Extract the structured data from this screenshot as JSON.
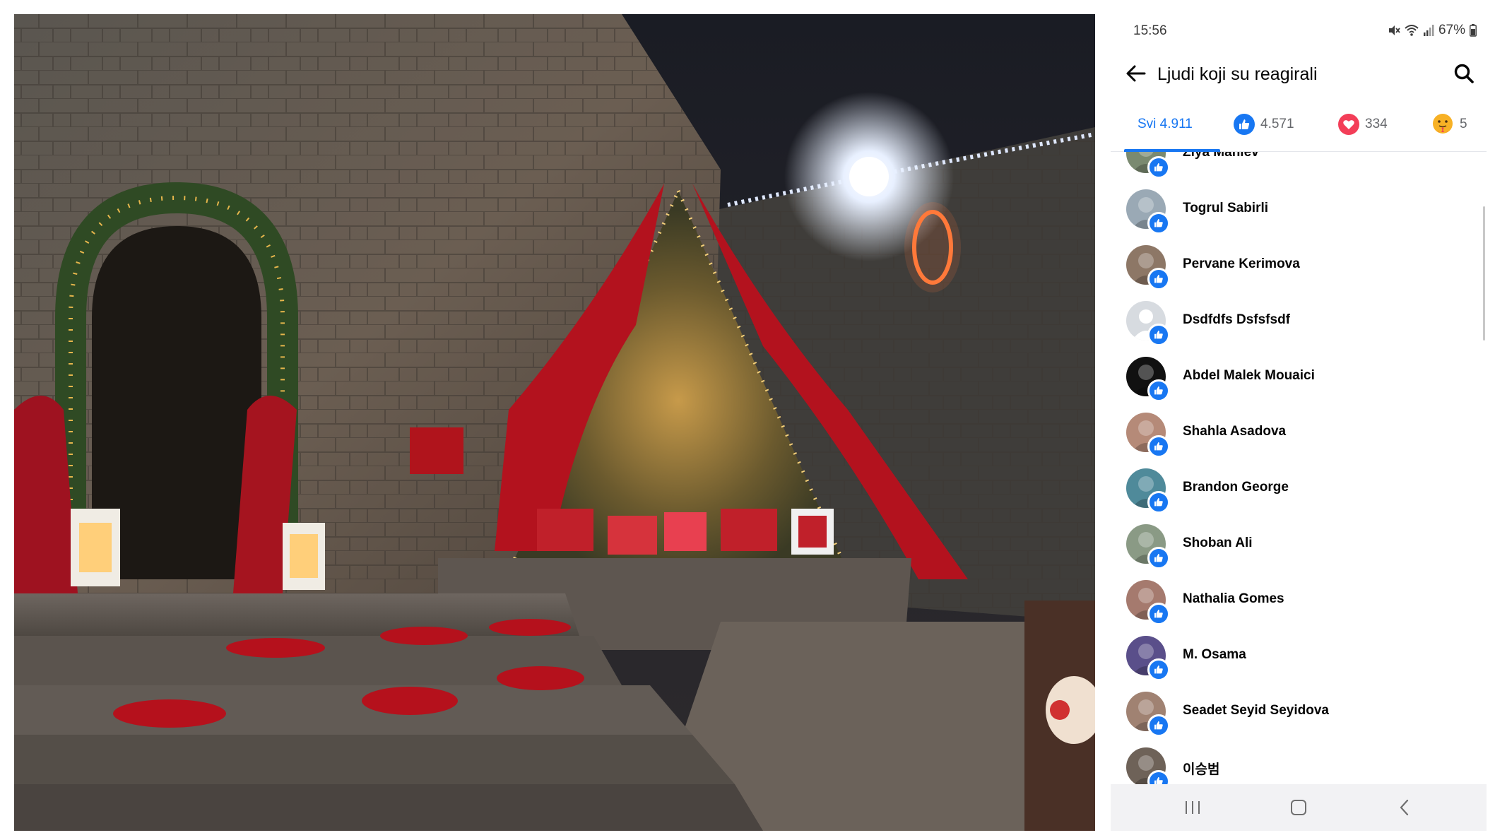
{
  "status_bar": {
    "time": "15:56",
    "battery": "67%",
    "icons": [
      "mute-icon",
      "wifi-icon",
      "signal-icon",
      "battery-icon"
    ]
  },
  "header": {
    "title": "Ljudi koji su reagirali",
    "back_icon": "arrow-left-icon",
    "search_icon": "search-icon"
  },
  "tabs": [
    {
      "label": "Svi 4.911",
      "icon": "",
      "active": true
    },
    {
      "label": "4.571",
      "icon": "like-icon",
      "active": false
    },
    {
      "label": "334",
      "icon": "love-icon",
      "active": false
    },
    {
      "label": "5",
      "icon": "care-icon",
      "active": false
    }
  ],
  "people": [
    {
      "name": "Ziya Maniev",
      "avatar_color": "#7a8a70"
    },
    {
      "name": "Togrul Sabirli",
      "avatar_color": "#9aa9b5"
    },
    {
      "name": "Pervane Kerimova",
      "avatar_color": "#8d7766"
    },
    {
      "name": "Dsdfdfs Dsfsfsdf",
      "avatar_color": "#d7dbe0"
    },
    {
      "name": "Abdel Malek Mouaici",
      "avatar_color": "#111111"
    },
    {
      "name": "Shahla Asadova",
      "avatar_color": "#b58a78"
    },
    {
      "name": "Brandon George",
      "avatar_color": "#4f8a9a"
    },
    {
      "name": "Shoban Ali",
      "avatar_color": "#8a9a85"
    },
    {
      "name": "Nathalia Gomes",
      "avatar_color": "#a57a6e"
    },
    {
      "name": "M. Osama",
      "avatar_color": "#5a4f8a"
    },
    {
      "name": "Seadet Seyid Seyidova",
      "avatar_color": "#a08272"
    },
    {
      "name": "이승범",
      "avatar_color": "#6e6258"
    }
  ],
  "nav": {
    "items": [
      "recent-apps-icon",
      "home-icon",
      "back-icon"
    ]
  },
  "colors": {
    "accent": "#1877f2",
    "love": "#f33e58",
    "text": "#050505",
    "muted": "#65676b"
  }
}
